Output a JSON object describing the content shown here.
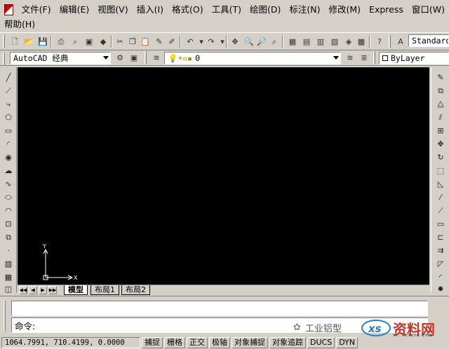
{
  "menubar": {
    "row1": [
      "文件(F)",
      "编辑(E)",
      "视图(V)",
      "插入(I)",
      "格式(O)",
      "工具(T)",
      "绘图(D)",
      "标注(N)",
      "修改(M)",
      "Express",
      "窗口(W)"
    ],
    "row2": [
      "帮助(H)"
    ]
  },
  "toolbar1": {
    "text_style_combo": "Standard"
  },
  "toolbar2": {
    "workspace_combo": "AutoCAD 经典",
    "layer_combo": "0",
    "color_combo": "ByLayer"
  },
  "drawing": {
    "ucs_y": "Y",
    "ucs_x": "X"
  },
  "tabs": {
    "model": "模型",
    "layout1": "布局1",
    "layout2": "布局2"
  },
  "command": {
    "prompt": "命令:",
    "input_value": ""
  },
  "statusbar": {
    "coordinates": "1064.7991, 710.4199, 0.0000",
    "buttons": [
      "捕捉",
      "栅格",
      "正交",
      "极轴",
      "对象捕捉",
      "对象追踪",
      "DUCS",
      "DYN"
    ]
  },
  "watermark": {
    "source": "工业铝型",
    "logo_text": "资料网",
    "logo_url": "ZL.XS1616.COM"
  },
  "colors": {
    "chrome": "#d4d0c8",
    "canvas": "#000000",
    "logo_red": "#c0392b"
  }
}
